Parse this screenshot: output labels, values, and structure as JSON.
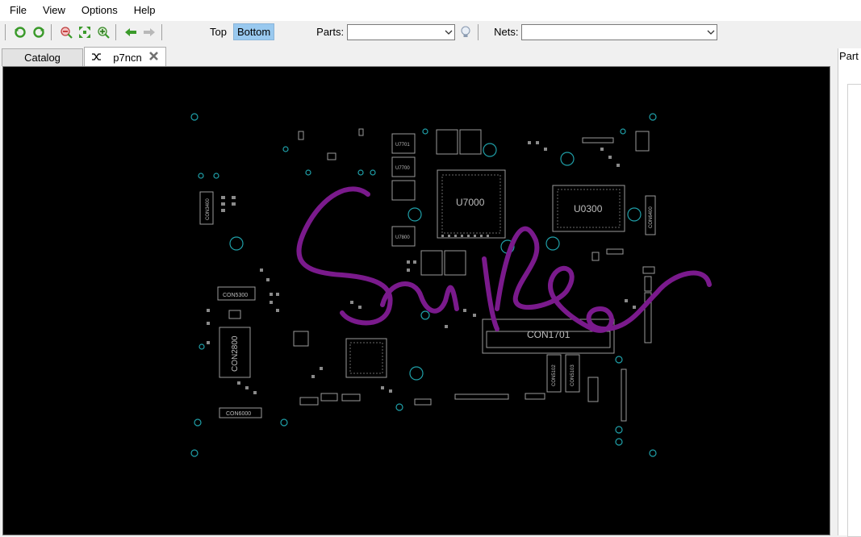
{
  "menu": [
    "File",
    "View",
    "Options",
    "Help"
  ],
  "toolbar": {
    "icons": [
      "rotate-left-icon",
      "rotate-right-icon",
      "zoom-out-icon",
      "fit-icon",
      "zoom-in-icon",
      "back-arrow-icon",
      "forward-arrow-icon"
    ],
    "side_top": "Top",
    "side_bottom": "Bottom",
    "active_side": "Bottom",
    "parts_label": "Parts:",
    "parts_value": "",
    "nets_label": "Nets:",
    "nets_value": ""
  },
  "tabs": [
    {
      "label": "Catalog",
      "active": false
    },
    {
      "label": "p7ncn",
      "active": true
    }
  ],
  "right_panel": {
    "tab_label": "Part"
  },
  "board": {
    "components": [
      "U7000",
      "U0300",
      "CON1701",
      "CON2800",
      "CON5300",
      "CON6000",
      "CON5102",
      "CON5103",
      "CON3400",
      "CON6400",
      "U7701",
      "U7700",
      "U7800"
    ]
  },
  "colors": {
    "canvas_bg": "#000000",
    "signature": "#7a1a8c",
    "via": "#1f9fa8",
    "parts": "#9a9a9a"
  }
}
